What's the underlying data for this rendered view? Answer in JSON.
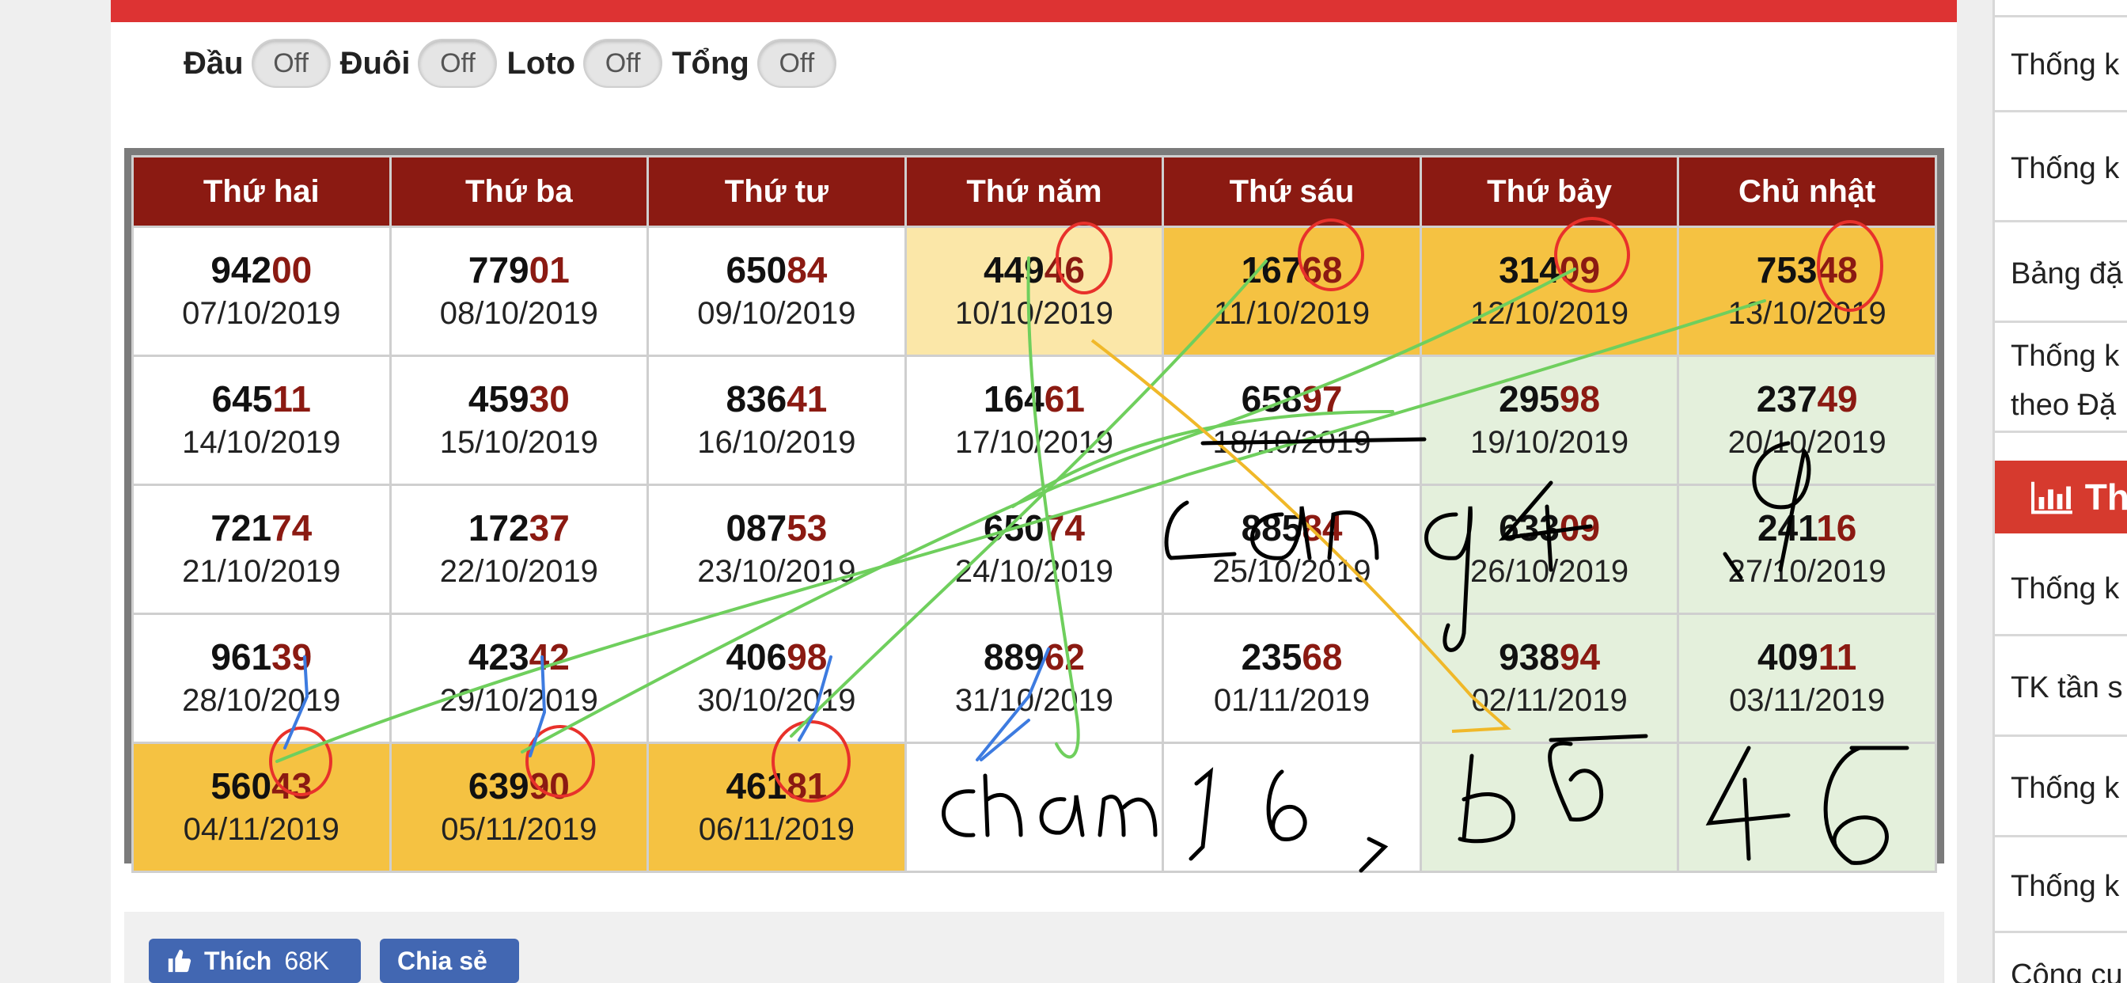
{
  "toggles": [
    {
      "label": "Đầu",
      "state": "Off"
    },
    {
      "label": "Đuôi",
      "state": "Off"
    },
    {
      "label": "Loto",
      "state": "Off"
    },
    {
      "label": "Tổng",
      "state": "Off"
    }
  ],
  "calendar": {
    "headers": [
      "Thứ hai",
      "Thứ ba",
      "Thứ tư",
      "Thứ năm",
      "Thứ sáu",
      "Thứ bảy",
      "Chủ nhật"
    ],
    "rows": [
      [
        {
          "head": "942",
          "tail": "00",
          "date": "07/10/2019"
        },
        {
          "head": "779",
          "tail": "01",
          "date": "08/10/2019"
        },
        {
          "head": "650",
          "tail": "84",
          "date": "09/10/2019"
        },
        {
          "head": "449",
          "tail": "46",
          "date": "10/10/2019"
        },
        {
          "head": "167",
          "tail": "68",
          "date": "11/10/2019"
        },
        {
          "head": "314",
          "tail": "09",
          "date": "12/10/2019"
        },
        {
          "head": "753",
          "tail": "48",
          "date": "13/10/2019"
        }
      ],
      [
        {
          "head": "645",
          "tail": "11",
          "date": "14/10/2019"
        },
        {
          "head": "459",
          "tail": "30",
          "date": "15/10/2019"
        },
        {
          "head": "836",
          "tail": "41",
          "date": "16/10/2019"
        },
        {
          "head": "164",
          "tail": "61",
          "date": "17/10/2019"
        },
        {
          "head": "658",
          "tail": "97",
          "date": "18/10/2019"
        },
        {
          "head": "295",
          "tail": "98",
          "date": "19/10/2019"
        },
        {
          "head": "237",
          "tail": "49",
          "date": "20/10/2019"
        }
      ],
      [
        {
          "head": "721",
          "tail": "74",
          "date": "21/10/2019"
        },
        {
          "head": "172",
          "tail": "37",
          "date": "22/10/2019"
        },
        {
          "head": "087",
          "tail": "53",
          "date": "23/10/2019"
        },
        {
          "head": "650",
          "tail": "74",
          "date": "24/10/2019"
        },
        {
          "head": "885",
          "tail": "84",
          "date": "25/10/2019"
        },
        {
          "head": "633",
          "tail": "09",
          "date": "26/10/2019"
        },
        {
          "head": "241",
          "tail": "16",
          "date": "27/10/2019"
        }
      ],
      [
        {
          "head": "961",
          "tail": "39",
          "date": "28/10/2019"
        },
        {
          "head": "423",
          "tail": "42",
          "date": "29/10/2019"
        },
        {
          "head": "406",
          "tail": "98",
          "date": "30/10/2019"
        },
        {
          "head": "889",
          "tail": "62",
          "date": "31/10/2019"
        },
        {
          "head": "235",
          "tail": "68",
          "date": "01/11/2019"
        },
        {
          "head": "938",
          "tail": "94",
          "date": "02/11/2019"
        },
        {
          "head": "409",
          "tail": "11",
          "date": "03/11/2019"
        }
      ],
      [
        {
          "head": "560",
          "tail": "43",
          "date": "04/11/2019"
        },
        {
          "head": "639",
          "tail": "90",
          "date": "05/11/2019"
        },
        {
          "head": "461",
          "tail": "81",
          "date": "06/11/2019"
        },
        {
          "head": "",
          "tail": "",
          "date": ""
        },
        {
          "head": "",
          "tail": "",
          "date": ""
        },
        {
          "head": "",
          "tail": "",
          "date": ""
        },
        {
          "head": "",
          "tail": "",
          "date": ""
        }
      ]
    ]
  },
  "handwriting": {
    "line1": "Lang 49",
    "line2": "chạm 1,6 , bố 46"
  },
  "share": {
    "like_label": "Thích",
    "like_count": "68K",
    "share_label": "Chia sẻ"
  },
  "right_sidebar": {
    "items_top": [
      "Thống k",
      "Thống k",
      "Bảng đặ"
    ],
    "item_two_line": [
      "Thống k",
      "theo Đặ"
    ],
    "header": "Th",
    "items_bottom": [
      "Thống k",
      "TK tần s",
      "Thống k",
      "Thống k",
      "Công cụ"
    ]
  },
  "colors": {
    "header_bg": "#8b1a12",
    "tail_digits": "#8b1a12",
    "gold_cell": "#f5c242",
    "pale_cell": "#fbe7a8",
    "green_cell": "#e4f0dc",
    "top_bar": "#dd3333",
    "fb_blue": "#4267b2"
  }
}
